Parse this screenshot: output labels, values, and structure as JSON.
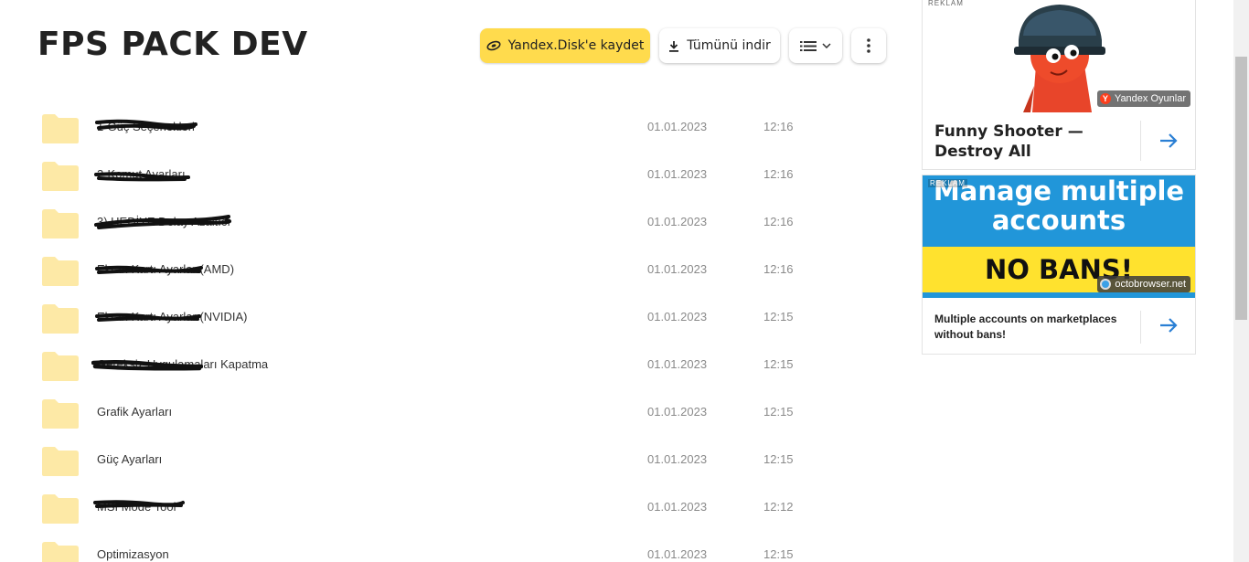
{
  "page": {
    "title": "FPS PACK DEV"
  },
  "toolbar": {
    "save_label": "Yandex.Disk'e kaydet",
    "download_label": "Tümünü indir"
  },
  "files": [
    {
      "name": "1-Güç Seçenekleri",
      "date": "01.01.2023",
      "time": "12:16"
    },
    {
      "name": "2-Komut Ayarları",
      "date": "01.01.2023",
      "time": "12:16"
    },
    {
      "name": "3) HEDİYE Delay Azaltıcı",
      "date": "01.01.2023",
      "time": "12:16"
    },
    {
      "name": "Ekran Kartı Ayarları(AMD)",
      "date": "01.01.2023",
      "time": "12:16"
    },
    {
      "name": "Ekran Kartı Ayarları(NVIDIA)",
      "date": "01.01.2023",
      "time": "12:15"
    },
    {
      "name": "Gereksiz Uygulamaları Kapatma",
      "date": "01.01.2023",
      "time": "12:15"
    },
    {
      "name": "Grafik Ayarları",
      "date": "01.01.2023",
      "time": "12:15"
    },
    {
      "name": "Güç Ayarları",
      "date": "01.01.2023",
      "time": "12:15"
    },
    {
      "name": "MSİ Mode Tool",
      "date": "01.01.2023",
      "time": "12:12"
    },
    {
      "name": "Optimizasyon",
      "date": "01.01.2023",
      "time": "12:15"
    }
  ],
  "ad1": {
    "label": "REKLAM",
    "badge": "Yandex Oyunlar",
    "title": "Funny Shooter — Destroy All"
  },
  "ad2": {
    "label": "REKLAM",
    "headline": "Manage multiple accounts",
    "subheadline": "NO BANS!",
    "badge": "octobrowser.net",
    "text": "Multiple accounts on marketplaces without bans!"
  },
  "colors": {
    "accent": "#ffdb4d",
    "folder": "#fde9a6",
    "link_arrow": "#2a7fd4"
  }
}
